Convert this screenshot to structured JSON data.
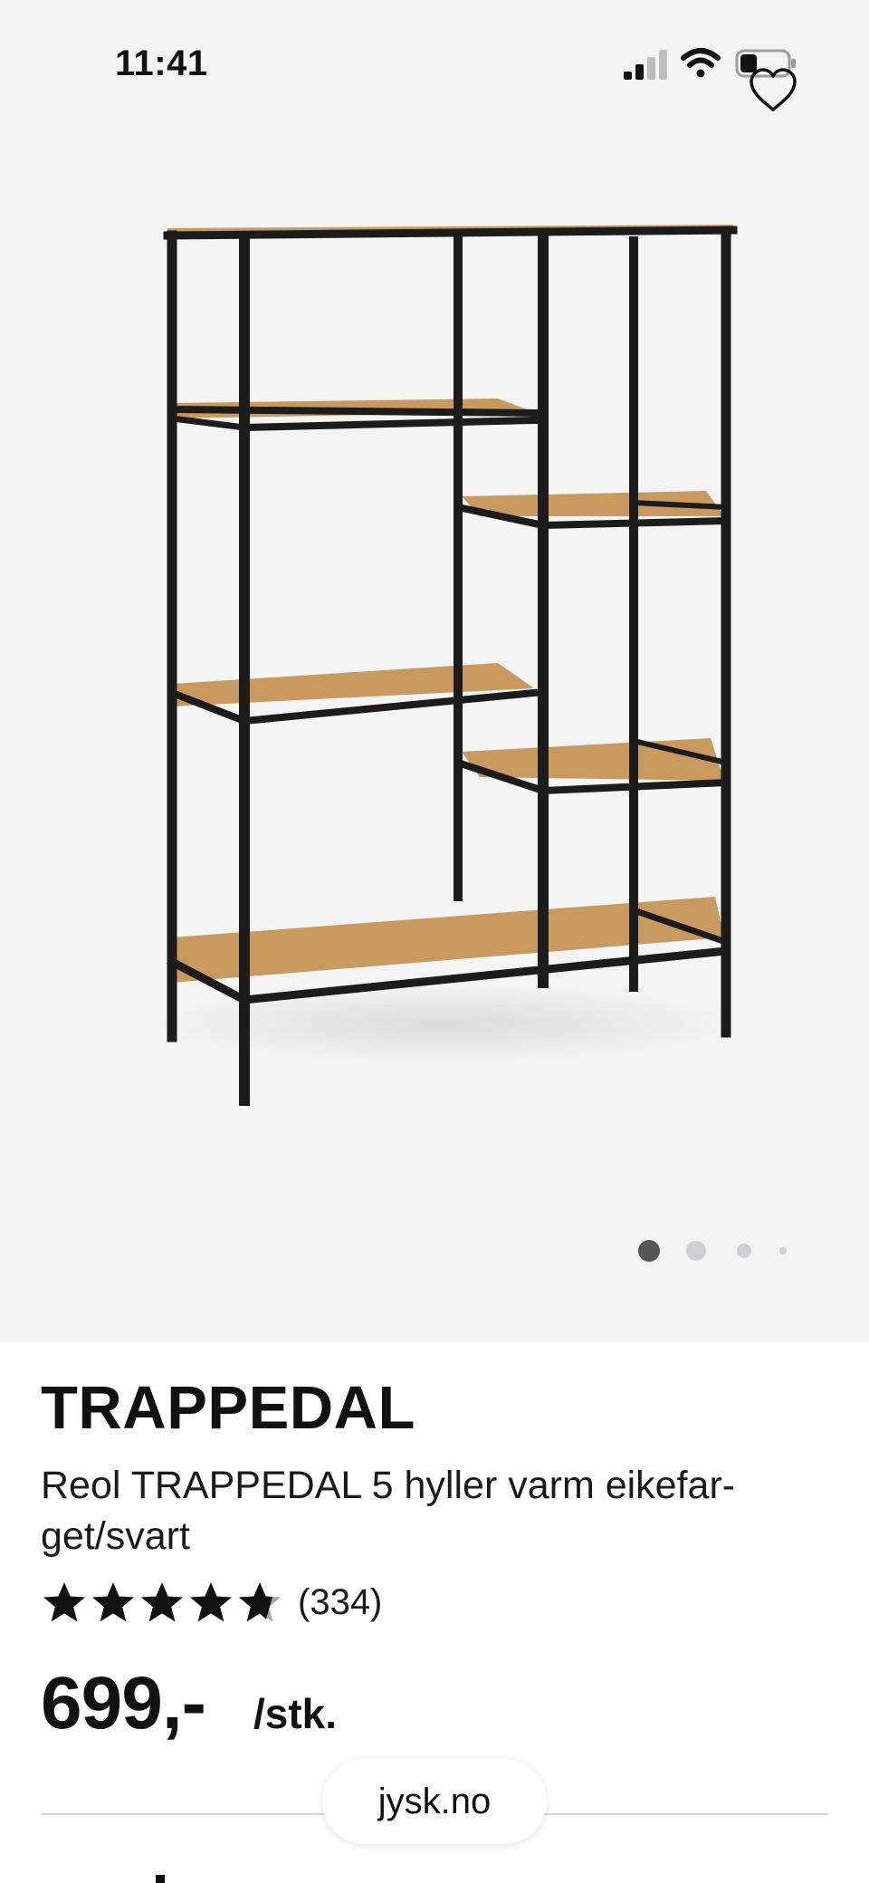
{
  "status_bar": {
    "time": "11:41"
  },
  "gallery": {
    "image_alt": "TRAPPEDAL shelving unit",
    "slide_count": 4,
    "active_slide": 1
  },
  "product": {
    "brand": "TRAPPEDAL",
    "title": "Reol TRAPPEDAL 5 hyller varm eikefar-get/svart",
    "rating": 4.5,
    "rating_max": 5,
    "review_count": "(334)",
    "price": "699,-",
    "unit": "/stk."
  },
  "browser": {
    "url": "jysk.no"
  },
  "colors": {
    "gallery_bg": "#f4f4f5",
    "text": "#111111",
    "frame": "#1c1c1c",
    "oak": "#c99a60",
    "active_dot": "#555555",
    "inactive_dot": "#cfcfd1"
  },
  "icons": {
    "signal": "signal-icon",
    "wifi": "wifi-icon",
    "battery": "battery-icon",
    "favorite": "heart-icon",
    "rating": "star-icon"
  }
}
